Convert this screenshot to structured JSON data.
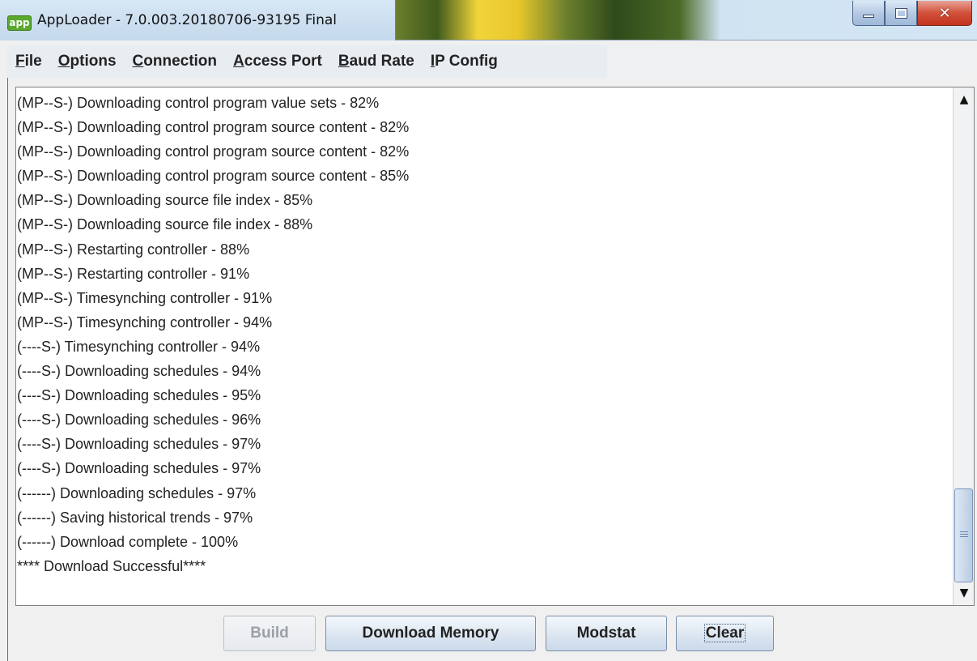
{
  "window": {
    "app_icon_text": "app",
    "title": "AppLoader - 7.0.003.20180706-93195 Final"
  },
  "menu": [
    {
      "accel": "F",
      "rest": "ile"
    },
    {
      "accel": "O",
      "rest": "ptions"
    },
    {
      "accel": "C",
      "rest": "onnection"
    },
    {
      "accel": "A",
      "rest": "ccess Port"
    },
    {
      "accel": "B",
      "rest": "aud Rate"
    },
    {
      "accel": "I",
      "rest": "P Config"
    }
  ],
  "log": {
    "lines": [
      "(MP--S-) Downloading control program value sets - 82%",
      "(MP--S-) Downloading control program source content - 82%",
      "(MP--S-) Downloading control program source content - 82%",
      "(MP--S-) Downloading control program source content - 85%",
      "(MP--S-) Downloading source file index - 85%",
      "(MP--S-) Downloading source file index - 88%",
      "(MP--S-) Restarting controller - 88%",
      "(MP--S-) Restarting controller - 91%",
      "(MP--S-) Timesynching controller - 91%",
      "(MP--S-) Timesynching controller - 94%",
      "(----S-) Timesynching controller - 94%",
      "(----S-) Downloading schedules - 94%",
      "(----S-) Downloading schedules - 95%",
      "(----S-) Downloading schedules - 96%",
      "(----S-) Downloading schedules - 97%",
      "(----S-) Downloading schedules - 97%",
      "(------) Downloading schedules - 97%",
      "(------) Saving historical trends - 97%",
      "(------) Download complete - 100%",
      "**** Download Successful****"
    ]
  },
  "buttons": {
    "build": "Build",
    "download_memory": "Download Memory",
    "modstat": "Modstat",
    "clear": "Clear"
  },
  "colors": {
    "accent_button_border": "#7a8ea8",
    "close_button": "#c2331c",
    "app_badge": "#5aa82e"
  },
  "icons": {
    "scroll_up": "▲",
    "scroll_down": "▼",
    "close": "✕"
  }
}
